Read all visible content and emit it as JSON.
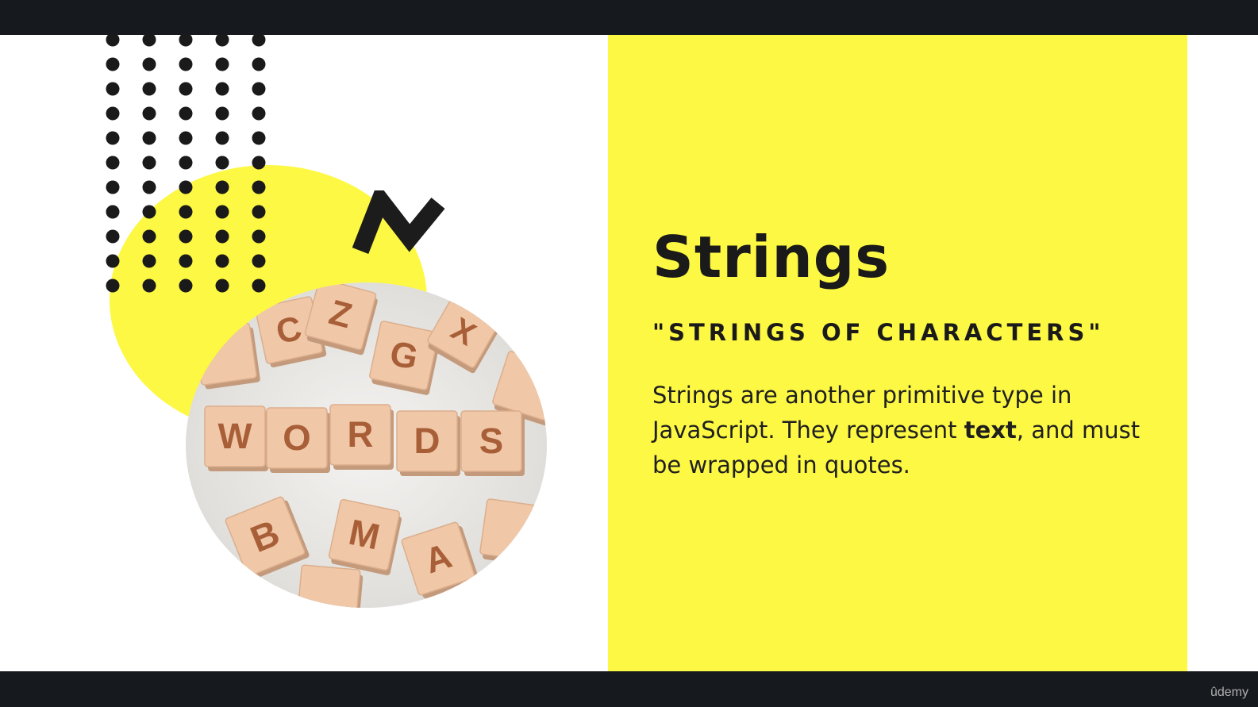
{
  "slide": {
    "title": "Strings",
    "subtitle": "\"STRINGS OF CHARACTERS\"",
    "body_before": "Strings are another primitive type in JavaScript.  They represent ",
    "body_bold": "text",
    "body_after": ", and must be wrapped in quotes."
  },
  "photo": {
    "word_letters": [
      "W",
      "O",
      "R",
      "D",
      "S"
    ],
    "scattered_letters": [
      "C",
      "Z",
      "G",
      "X",
      "B",
      "M",
      "A"
    ]
  },
  "watermark": {
    "text": "ûdemy"
  },
  "colors": {
    "accent_yellow": "#fdf843",
    "ink": "#1a1a1a",
    "frame": "#16191e",
    "cube": "#f0c8a8"
  },
  "icons": {
    "dots": "dot-grid-decoration",
    "zigzag": "zigzag-decoration",
    "circle": "yellow-circle-decoration"
  }
}
